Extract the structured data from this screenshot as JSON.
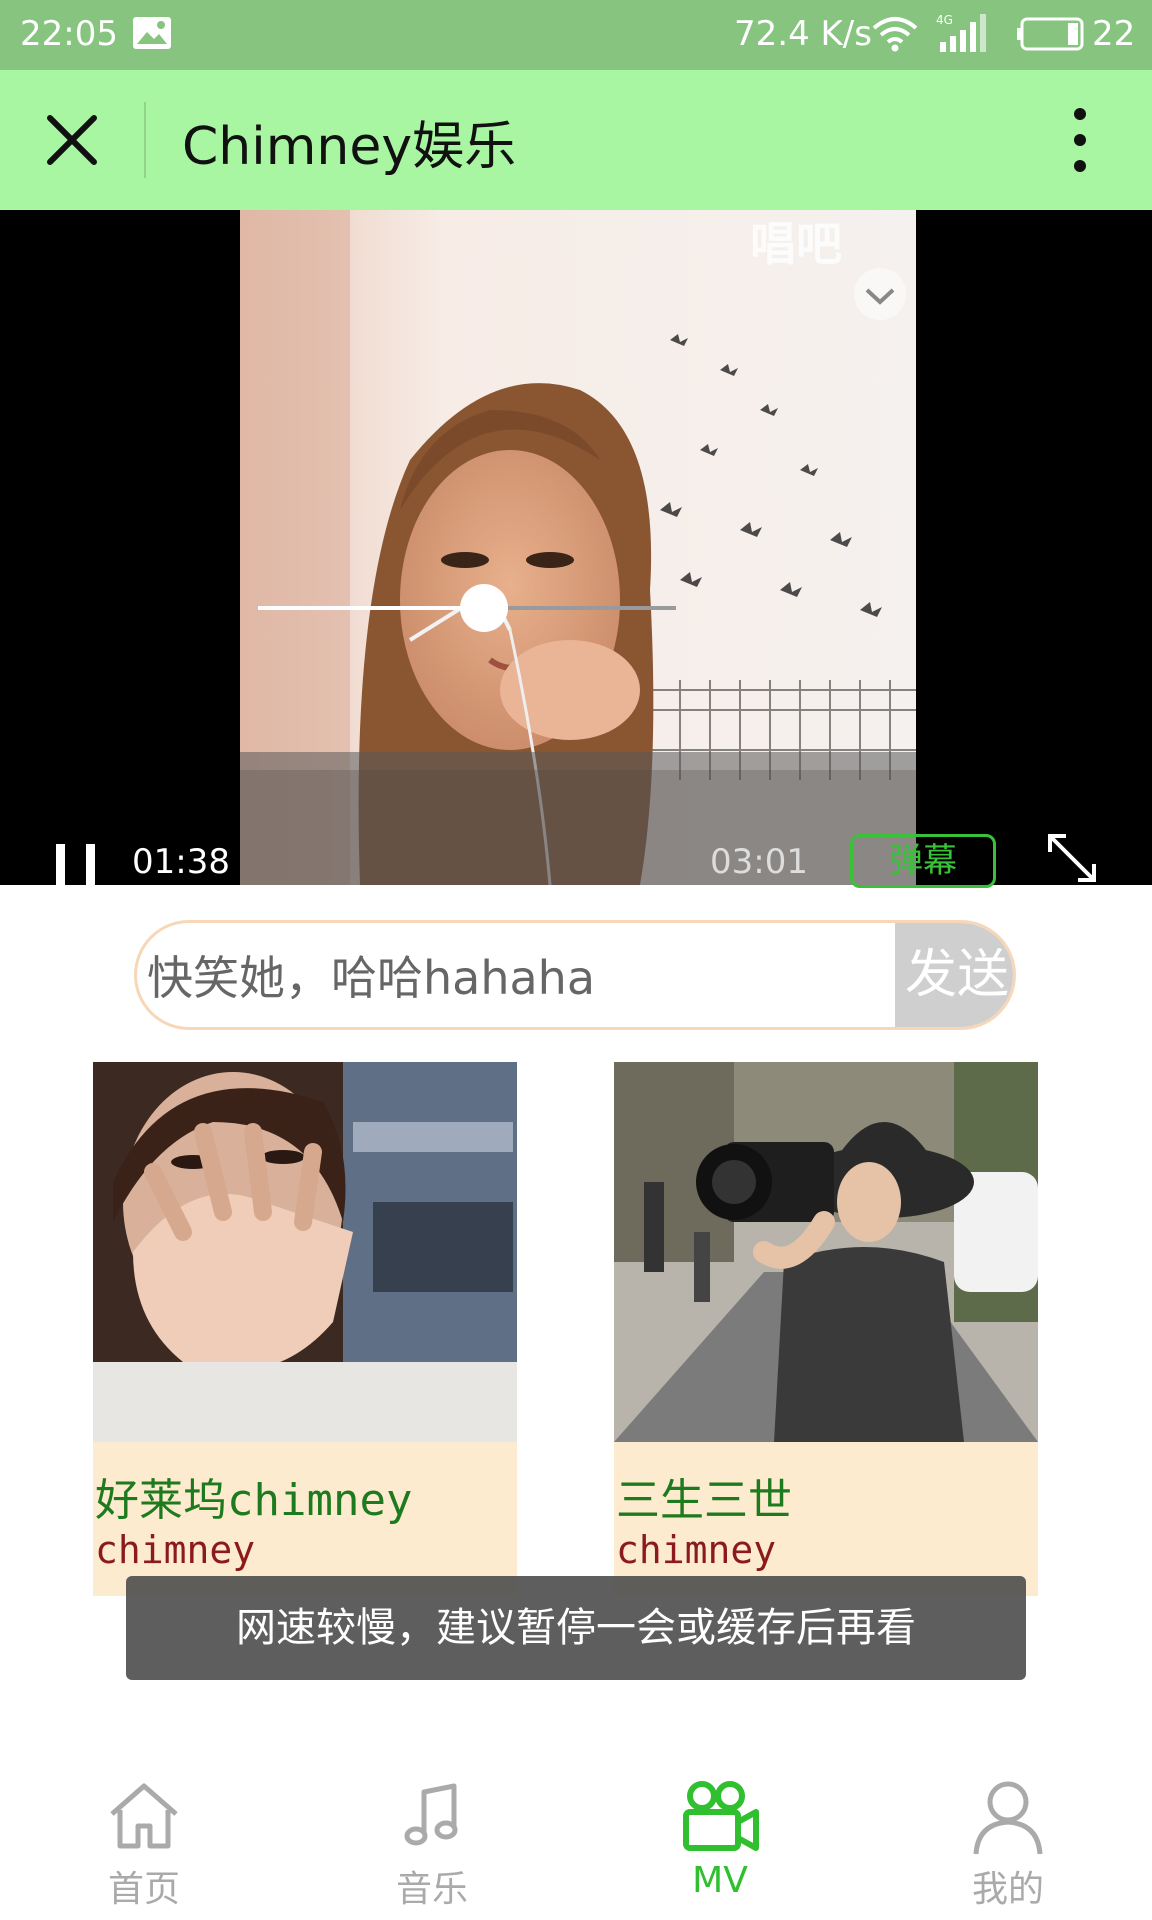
{
  "status_bar": {
    "time": "22:05",
    "network_speed": "72.4 K/s",
    "network_type": "4G",
    "battery": "22",
    "icons": [
      "image-icon",
      "wifi-icon",
      "signal-icon",
      "battery-icon"
    ]
  },
  "app_bar": {
    "title": "Chimney娱乐",
    "close_icon": "close-icon",
    "more_icon": "more-vertical-icon"
  },
  "player": {
    "current_time": "01:38",
    "total_time": "03:01",
    "progress": 0.54,
    "danmu_label": "弹幕",
    "watermark": "唱吧"
  },
  "comment": {
    "input_value": "快笑她，哈哈hahaha",
    "send_label": "发送"
  },
  "cards": [
    {
      "title": "好莱坞chimney",
      "artist": "chimney"
    },
    {
      "title": "三生三世",
      "artist": "chimney"
    }
  ],
  "toast": "网速较慢，建议暂停一会或缓存后再看",
  "bottom_nav": [
    {
      "label": "首页",
      "icon": "home-icon",
      "active": false
    },
    {
      "label": "音乐",
      "icon": "music-note-icon",
      "active": false
    },
    {
      "label": "MV",
      "icon": "video-camera-icon",
      "active": true
    },
    {
      "label": "我的",
      "icon": "user-icon",
      "active": false
    }
  ],
  "colors": {
    "status_bar": "#86c47f",
    "app_bar": "#a8f5a2",
    "accent_green": "#2fbf2f",
    "card_bg": "#fdebcf",
    "card_title": "#1e7a1e",
    "card_artist": "#8b1a1a"
  }
}
